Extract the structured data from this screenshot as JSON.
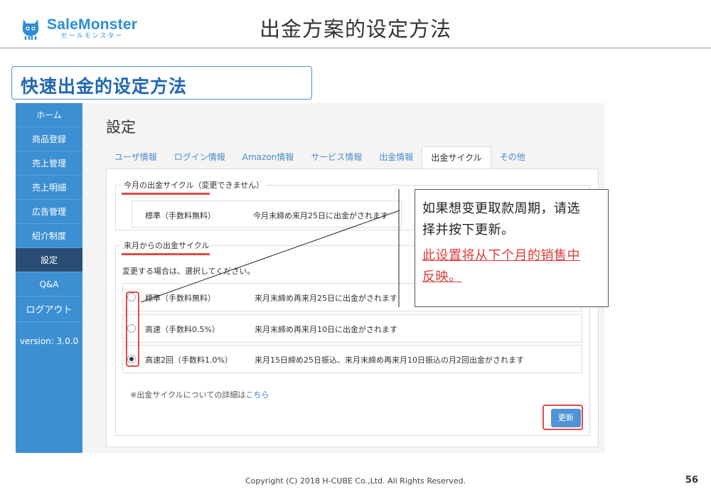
{
  "header": {
    "logo_name": "SaleMonster",
    "logo_sub": "セールモンスター",
    "slide_title": "出金方案的设定方法",
    "section_title": "快速出金的设定方法"
  },
  "sidebar": {
    "items": [
      {
        "label": "ホーム",
        "active": false
      },
      {
        "label": "商品登録",
        "active": false
      },
      {
        "label": "売上管理",
        "active": false
      },
      {
        "label": "売上明細",
        "active": false
      },
      {
        "label": "広告管理",
        "active": false
      },
      {
        "label": "紹介制度",
        "active": false
      },
      {
        "label": "設定",
        "active": true
      },
      {
        "label": "Q&A",
        "active": false
      },
      {
        "label": "ログアウト",
        "active": false
      }
    ],
    "version": "version: 3.0.0"
  },
  "main": {
    "title": "設定",
    "tabs": [
      {
        "label": "ユーザ情報",
        "active": false
      },
      {
        "label": "ログイン情報",
        "active": false
      },
      {
        "label": "Amazon情報",
        "active": false
      },
      {
        "label": "サービス情報",
        "active": false
      },
      {
        "label": "出金情報",
        "active": false
      },
      {
        "label": "出金サイクル",
        "active": true
      },
      {
        "label": "その他",
        "active": false
      }
    ],
    "current_cycle": {
      "legend": "今月の出金サイクル（変更できません）",
      "name": "標準（手数料無料）",
      "desc": "今月末締め来月25日に出金がされます"
    },
    "next_cycle": {
      "legend": "来月からの出金サイクル",
      "hint": "変更する場合は、選択してください。",
      "options": [
        {
          "name": "標準（手数料無料）",
          "desc": "来月末締め再来月25日に出金がされます",
          "checked": false
        },
        {
          "name": "高速（手数料0.5%）",
          "desc": "来月末締め再来月10日に出金がされます",
          "checked": false
        },
        {
          "name": "高速2回（手数料1.0%）",
          "desc": "来月15日締め25日振込、来月末締め再来月10日振込の月2回出金がされます",
          "checked": true
        }
      ]
    },
    "note_prefix": "※出金サイクルについての詳細は",
    "note_link": "こちら",
    "update_label": "更新"
  },
  "callout": {
    "line1": "如果想变更取款周期，请选",
    "line2": "择并按下更新。",
    "red1": "此设置将从下个月的销售中",
    "red2": "反映。"
  },
  "footer": {
    "copyright": "Copyright (C) 2018 H-CUBE Co.,Ltd. All Rights Reserved.",
    "page": "56"
  },
  "colors": {
    "accent": "#3c8fd3",
    "sidebar_active": "#2a4d73",
    "highlight_red": "#e34a4a",
    "title_blue": "#1f67b7"
  }
}
